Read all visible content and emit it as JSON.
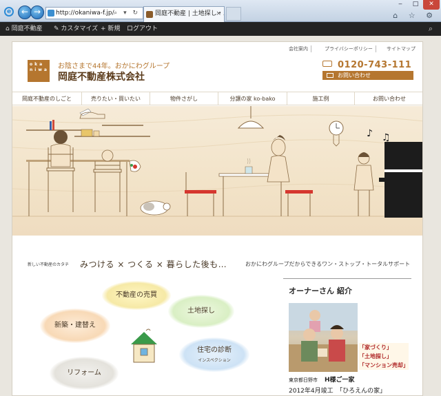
{
  "browser": {
    "url": "http://okaniwa-f.jp/",
    "tab_title": "岡庭不動産 | 土地探し・...",
    "tab_close": "×",
    "win_min": "‒",
    "win_max": "□",
    "win_close": "✕",
    "back_glyph": "←",
    "fwd_glyph": "→",
    "address_tools": "⌕ ▾ ↻",
    "right_icons": "⌂ ☆ ⚙"
  },
  "adminbar": {
    "site_name": "岡庭不動産",
    "customize": "カスタマイズ",
    "new": "新規",
    "logout": "ログアウト",
    "search_icon": "⌕"
  },
  "header": {
    "utility_links": [
      "会社案内",
      "プライバシーポリシー",
      "サイトマップ"
    ],
    "logo_text": [
      "oka",
      "niwa"
    ],
    "tagline": "お陰さまで44年。おかにわグループ",
    "company": "岡庭不動産株式会社",
    "phone": "0120-743-111",
    "contact_button": "お問い合わせ"
  },
  "nav": {
    "items": [
      "岡庭不動産のしごと",
      "売りたい・買いたい",
      "物件さがし",
      "分譲の家 ko-bako",
      "施工例",
      "お問い合わせ"
    ]
  },
  "tagrow": {
    "label": "新しい不動産のカタチ",
    "motto": "みつける × つくる × 暮らした後も…",
    "sub": "おかにわグループだからできるワン・ストップ・トータルサポート"
  },
  "bubbles": [
    "不動産の売買",
    "土地探し",
    "新築・建替え",
    "住宅の診断",
    "インスペクション",
    "リフォーム"
  ],
  "owner": {
    "title": "オーナーさん 紹介",
    "badges": [
      "「家づくり」",
      "「土地探し」",
      "「マンション売却」"
    ],
    "location": "東京都日野市",
    "name": "H様ご一家",
    "date": "2012年4月竣工　「ひろえんの家」"
  },
  "colors": {
    "brand": "#b5762f",
    "admin_bar": "#232323",
    "piano": "#1c1c1c",
    "stool_red": "#d5372f"
  }
}
